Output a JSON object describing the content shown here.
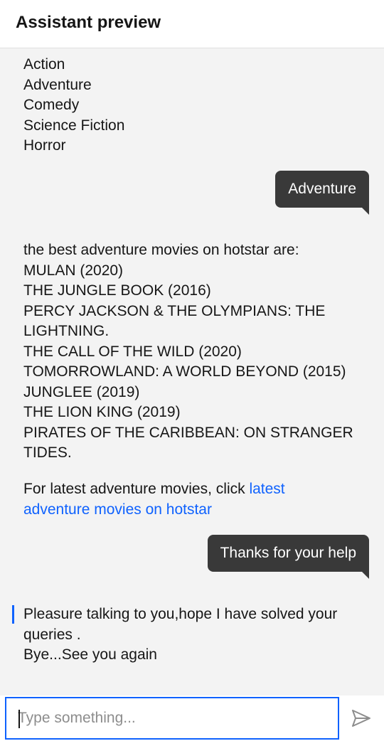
{
  "header": {
    "title": "Assistant preview"
  },
  "messages": {
    "options": [
      "Action",
      "Adventure",
      "Comedy",
      "Science Fiction",
      "Horror"
    ],
    "user_1": "Adventure",
    "movies": [
      "the best adventure movies on hotstar are:",
      "MULAN (2020)",
      "THE JUNGLE BOOK (2016)",
      "PERCY JACKSON & THE OLYMPIANS: THE",
      "LIGHTNING.",
      "THE CALL OF THE WILD (2020)",
      "TOMORROWLAND: A WORLD BEYOND (2015)",
      "JUNGLEE (2019)",
      "THE LION KING (2019)",
      "PIRATES OF THE CARIBBEAN: ON STRANGER",
      "TIDES."
    ],
    "latest_prefix": "For latest adventure movies, click ",
    "latest_link_1": "latest",
    "latest_link_2": "adventure movies on hotstar",
    "user_2": "Thanks for your help",
    "bye": [
      "Pleasure talking to you,hope I have solved your",
      "queries .",
      "Bye...See you again"
    ]
  },
  "composer": {
    "placeholder": "Type something...",
    "send_icon": "send-icon"
  },
  "colors": {
    "accent": "#0f62fe",
    "user_bubble": "#393939",
    "background": "#f3f3f3"
  }
}
